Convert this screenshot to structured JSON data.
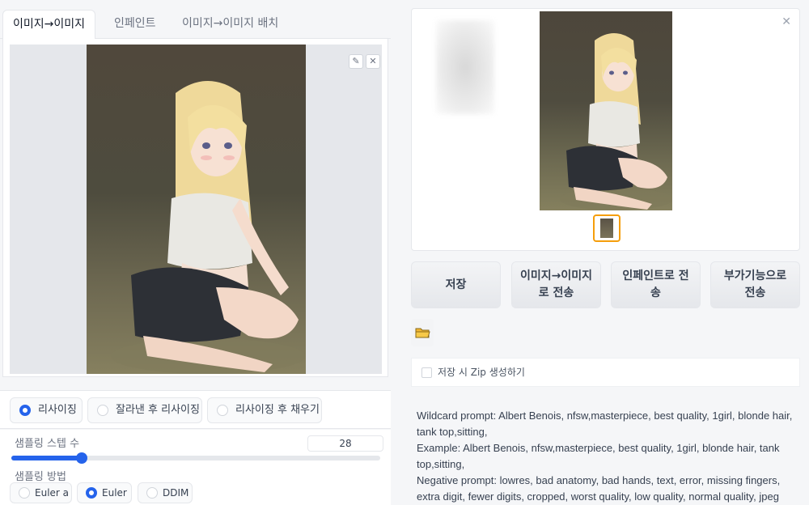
{
  "tabs": [
    {
      "label": "이미지→이미지"
    },
    {
      "label": "인페인트"
    },
    {
      "label": "이미지→이미지 배치"
    }
  ],
  "input_image": {
    "edit_icon": "pencil-icon",
    "clear_icon": "close-icon"
  },
  "resize": {
    "options": [
      {
        "label": "리사이징",
        "checked": true
      },
      {
        "label": "잘라낸 후 리사이징",
        "checked": false
      },
      {
        "label": "리사이징 후 채우기",
        "checked": false
      }
    ]
  },
  "steps": {
    "label": "샘플링 스텝 수",
    "value": "28",
    "fraction": 0.19
  },
  "sampler": {
    "label": "샘플링 방법",
    "options": [
      {
        "label": "Euler a",
        "checked": false
      },
      {
        "label": "Euler",
        "checked": true
      },
      {
        "label": "DDIM",
        "checked": false
      }
    ]
  },
  "gallery": {
    "close_icon": "close-icon"
  },
  "actions": {
    "save": "저장",
    "send_img2img": "이미지→이미지로 전송",
    "send_inpaint": "인페인트로 전송",
    "send_extras": "부가기능으로 전송"
  },
  "folder_icon": "folder-icon",
  "zip_label": "저장 시 Zip 생성하기",
  "info": {
    "wildcard": "Wildcard prompt: Albert Benois, nfsw,masterpiece, best quality, 1girl, blonde hair, tank top,sitting,",
    "example": "Example: Albert Benois, nfsw,masterpiece, best quality, 1girl, blonde hair, tank top,sitting,",
    "negative": "Negative prompt: lowres, bad anatomy, bad hands, text, error, missing fingers, extra digit, fewer digits, cropped, worst quality, low quality, normal quality, jpeg"
  }
}
